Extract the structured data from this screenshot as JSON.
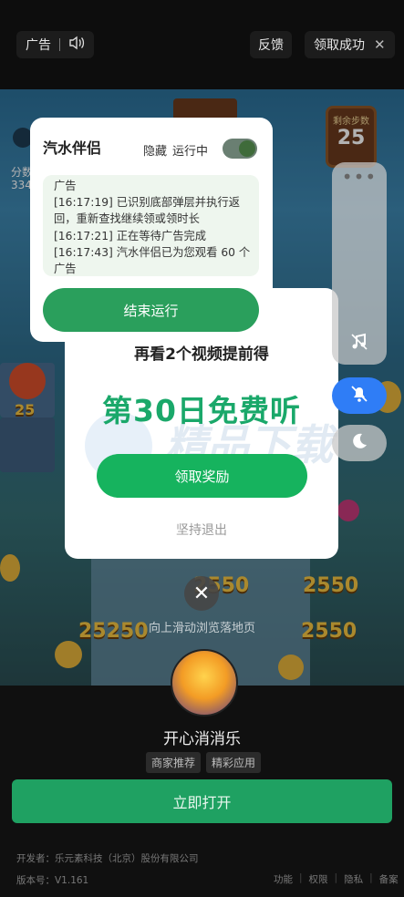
{
  "top_bar": {
    "ad_label": "广告",
    "speaker_icon": "speaker-icon",
    "feedback": "反馈",
    "claim_success": "领取成功",
    "close_glyph": "✕"
  },
  "game": {
    "remaining_steps_label": "剩余步数",
    "remaining_steps": "25",
    "score_label": "分数",
    "score_value": "334",
    "tile_score": "2550",
    "tile_score_long": "25250",
    "tile_level": "25"
  },
  "companion": {
    "title": "汽水伴侣",
    "hide": "隐藏",
    "status": "运行中",
    "toggle_on": true,
    "logs": [
      "广告",
      "[16:17:19] 已识别底部弹层并执行返回，重新查找继续领或领时长",
      "[16:17:21] 正在等待广告完成",
      "[16:17:43] 汽水伴侣已为您观看 60 个广告"
    ],
    "end_button": "结束运行"
  },
  "reward_dialog": {
    "subtitle": "再看2个视频提前得",
    "headline": "第30日免费听",
    "watermark": "精品下载",
    "claim_button": "领取奖励",
    "quit": "坚持退出"
  },
  "side_controls": {
    "more_icon": "more-dots-icon",
    "music_icon": "music-note-off-icon",
    "bell_icon": "bell-mute-icon",
    "moon_icon": "moon-icon",
    "accent_blue": "#2f7df6"
  },
  "overlay": {
    "close_glyph": "✕",
    "swipe_hint": "向上滑动浏览落地页"
  },
  "app_card": {
    "name": "开心消消乐",
    "tags": [
      "商家推荐",
      "精彩应用"
    ],
    "open_button": "立即打开",
    "developer": "开发者：乐元素科技（北京）股份有限公司",
    "version": "版本号：V1.161",
    "links": [
      "功能",
      "权限",
      "隐私",
      "备案"
    ],
    "accent_green": "#1fa162"
  }
}
